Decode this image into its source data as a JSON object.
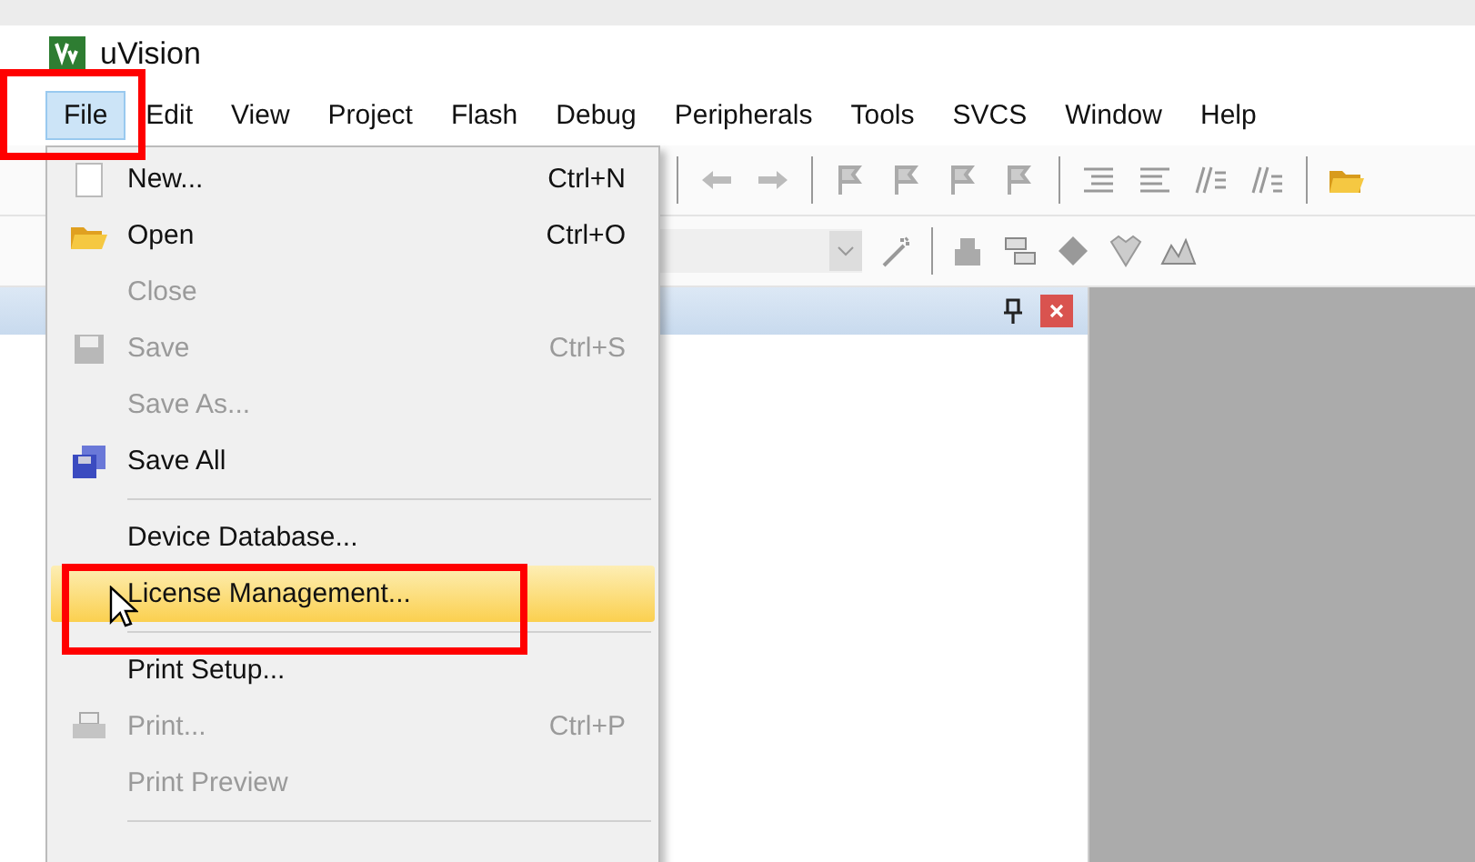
{
  "window": {
    "title": "uVision"
  },
  "menu_bar": [
    {
      "label": "File",
      "selected": true
    },
    {
      "label": "Edit",
      "selected": false
    },
    {
      "label": "View",
      "selected": false
    },
    {
      "label": "Project",
      "selected": false
    },
    {
      "label": "Flash",
      "selected": false
    },
    {
      "label": "Debug",
      "selected": false
    },
    {
      "label": "Peripherals",
      "selected": false
    },
    {
      "label": "Tools",
      "selected": false
    },
    {
      "label": "SVCS",
      "selected": false
    },
    {
      "label": "Window",
      "selected": false
    },
    {
      "label": "Help",
      "selected": false
    }
  ],
  "file_menu": {
    "items": [
      {
        "kind": "item",
        "label": "New...",
        "shortcut": "Ctrl+N",
        "disabled": false,
        "highlighted": false
      },
      {
        "kind": "item",
        "label": "Open",
        "shortcut": "Ctrl+O",
        "disabled": false,
        "highlighted": false
      },
      {
        "kind": "item",
        "label": "Close",
        "disabled": true,
        "highlighted": false
      },
      {
        "kind": "item",
        "label": "Save",
        "shortcut": "Ctrl+S",
        "disabled": true,
        "highlighted": false
      },
      {
        "kind": "item",
        "label": "Save As...",
        "disabled": true,
        "highlighted": false
      },
      {
        "kind": "item",
        "label": "Save All",
        "disabled": false,
        "highlighted": false
      },
      {
        "kind": "separator"
      },
      {
        "kind": "item",
        "label": "Device Database...",
        "disabled": false,
        "highlighted": false
      },
      {
        "kind": "item",
        "label": "License Management...",
        "disabled": false,
        "highlighted": true
      },
      {
        "kind": "separator"
      },
      {
        "kind": "item",
        "label": "Print Setup...",
        "disabled": false,
        "highlighted": false
      },
      {
        "kind": "item",
        "label": "Print...",
        "shortcut": "Ctrl+P",
        "disabled": true,
        "highlighted": false
      },
      {
        "kind": "item",
        "label": "Print Preview",
        "disabled": true,
        "highlighted": false
      },
      {
        "kind": "separator"
      }
    ]
  }
}
